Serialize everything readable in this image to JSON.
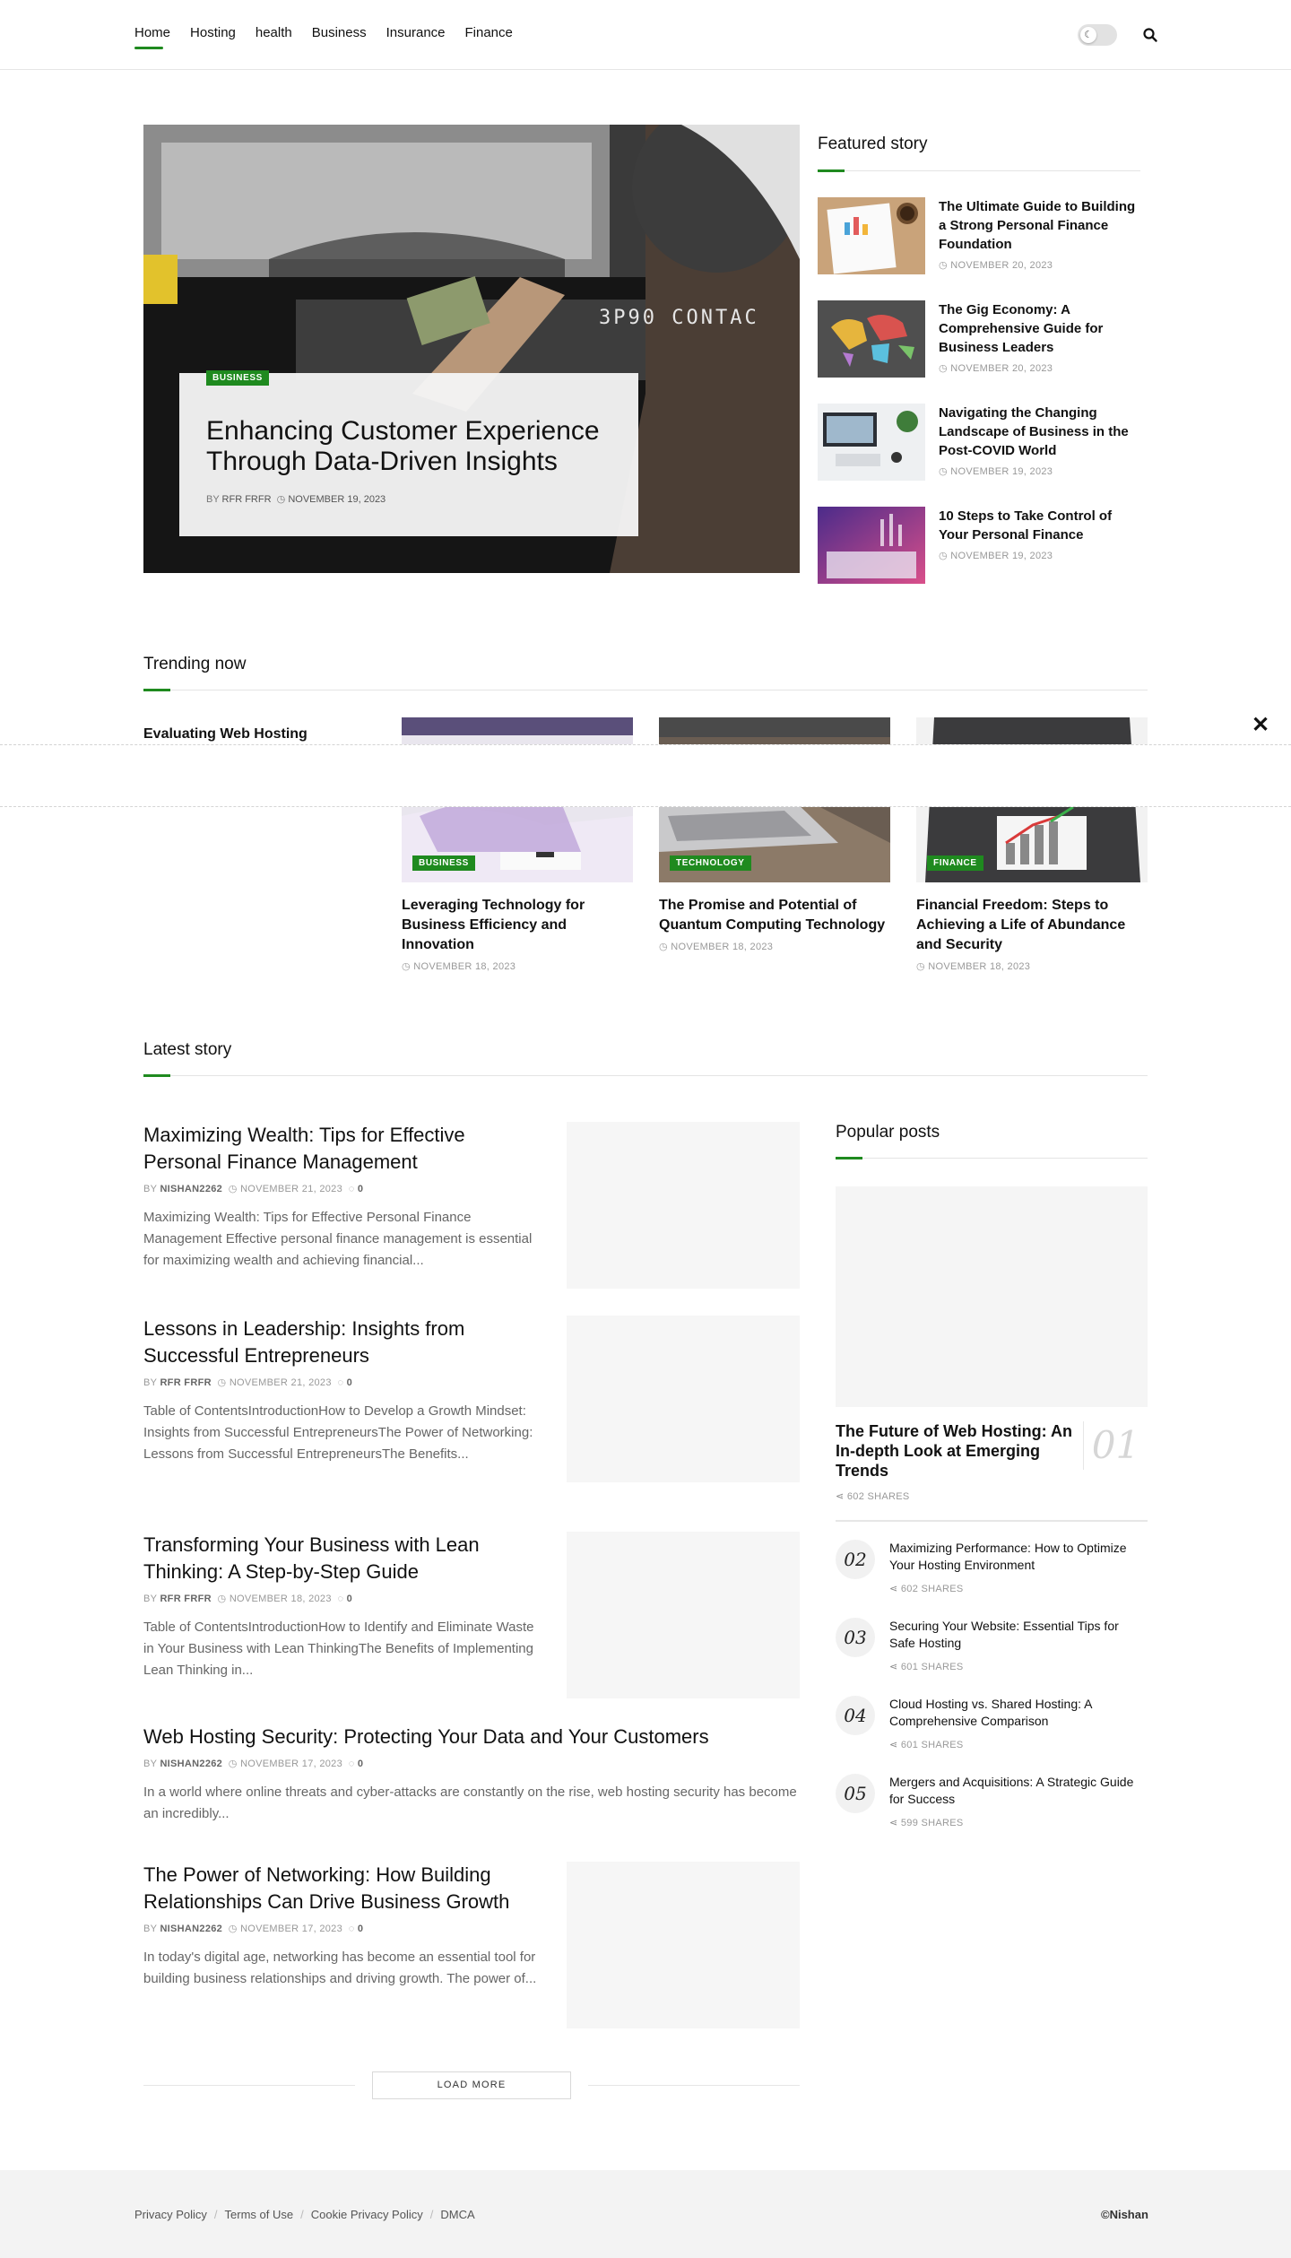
{
  "nav": {
    "items": [
      "Home",
      "Hosting",
      "health",
      "Business",
      "Insurance",
      "Finance"
    ],
    "active_index": 0
  },
  "theme_toggle": {
    "icon": "moon-icon"
  },
  "hero": {
    "category": "BUSINESS",
    "title": "Enhancing Customer Experience Through Data-Driven Insights",
    "author_prefix": "BY",
    "author": "RFR FRFR",
    "date": "NOVEMBER 19, 2023",
    "image_text": "3P90 CONTAC"
  },
  "featured": {
    "heading": "Featured story",
    "items": [
      {
        "title": "The Ultimate Guide to Building a Strong Personal Finance Foundation",
        "date": "NOVEMBER 20, 2023"
      },
      {
        "title": "The Gig Economy: A Comprehensive Guide for Business Leaders",
        "date": "NOVEMBER 20, 2023"
      },
      {
        "title": "Navigating the Changing Landscape of Business in the Post-COVID World",
        "date": "NOVEMBER 19, 2023"
      },
      {
        "title": "10 Steps to Take Control of Your Personal Finance",
        "date": "NOVEMBER 19, 2023"
      }
    ]
  },
  "trending": {
    "heading": "Trending now",
    "first_title": "Evaluating Web Hosting",
    "close_label": "✕",
    "items": [
      {
        "category": "BUSINESS",
        "title": "Leveraging Technology for Business Efficiency and Innovation",
        "date": "NOVEMBER 18, 2023"
      },
      {
        "category": "TECHNOLOGY",
        "title": "The Promise and Potential of Quantum Computing Technology",
        "date": "NOVEMBER 18, 2023"
      },
      {
        "category": "FINANCE",
        "title": "Financial Freedom: Steps to Achieving a Life of Abundance and Security",
        "date": "NOVEMBER 18, 2023"
      }
    ]
  },
  "latest": {
    "heading": "Latest story",
    "posts": [
      {
        "title": "Maximizing Wealth: Tips for Effective Personal Finance Management",
        "author": "NISHAN2262",
        "date": "NOVEMBER 21, 2023",
        "comments": "0",
        "excerpt": "Maximizing Wealth: Tips for Effective Personal Finance Management Effective personal finance management is essential for maximizing wealth and achieving financial..."
      },
      {
        "title": "Lessons in Leadership: Insights from Successful Entrepreneurs",
        "author": "RFR FRFR",
        "date": "NOVEMBER 21, 2023",
        "comments": "0",
        "excerpt": "Table of ContentsIntroductionHow to Develop a Growth Mindset: Insights from Successful EntrepreneursThe Power of Networking: Lessons from Successful EntrepreneursThe Benefits..."
      },
      {
        "title": "Transforming Your Business with Lean Thinking: A Step-by-Step Guide",
        "author": "RFR FRFR",
        "date": "NOVEMBER 18, 2023",
        "comments": "0",
        "excerpt": "Table of ContentsIntroductionHow to Identify and Eliminate Waste in Your Business with Lean ThinkingThe Benefits of Implementing Lean Thinking in..."
      },
      {
        "title": "Web Hosting Security: Protecting Your Data and Your Customers",
        "author": "NISHAN2262",
        "date": "NOVEMBER 17, 2023",
        "comments": "0",
        "excerpt": "In a world where online threats and cyber-attacks are constantly on the rise, web hosting security has become an incredibly..."
      },
      {
        "title": "The Power of Networking: How Building Relationships Can Drive Business Growth",
        "author": "NISHAN2262",
        "date": "NOVEMBER 17, 2023",
        "comments": "0",
        "excerpt": "In today's digital age, networking has become an essential tool for building business relationships and driving growth. The power of..."
      }
    ],
    "author_prefix": "BY",
    "load_more": "LOAD MORE"
  },
  "popular": {
    "heading": "Popular posts",
    "first": {
      "number": "01",
      "title": "The Future of Web Hosting: An In-depth Look at Emerging Trends",
      "shares": "602 SHARES"
    },
    "items": [
      {
        "number": "02",
        "title": "Maximizing Performance: How to Optimize Your Hosting Environment",
        "shares": "602 SHARES"
      },
      {
        "number": "03",
        "title": "Securing Your Website: Essential Tips for Safe Hosting",
        "shares": "601 SHARES"
      },
      {
        "number": "04",
        "title": "Cloud Hosting vs. Shared Hosting: A Comprehensive Comparison",
        "shares": "601 SHARES"
      },
      {
        "number": "05",
        "title": "Mergers and Acquisitions: A Strategic Guide for Success",
        "shares": "599 SHARES"
      }
    ]
  },
  "footer": {
    "links": [
      "Privacy Policy",
      "Terms of Use",
      "Cookie Privacy Policy",
      "DMCA"
    ],
    "copyright": "©Nishan"
  },
  "colors": {
    "accent": "#1f8a1f",
    "text": "#111111",
    "muted": "#999999",
    "footer_bg": "#f3f3f3"
  }
}
